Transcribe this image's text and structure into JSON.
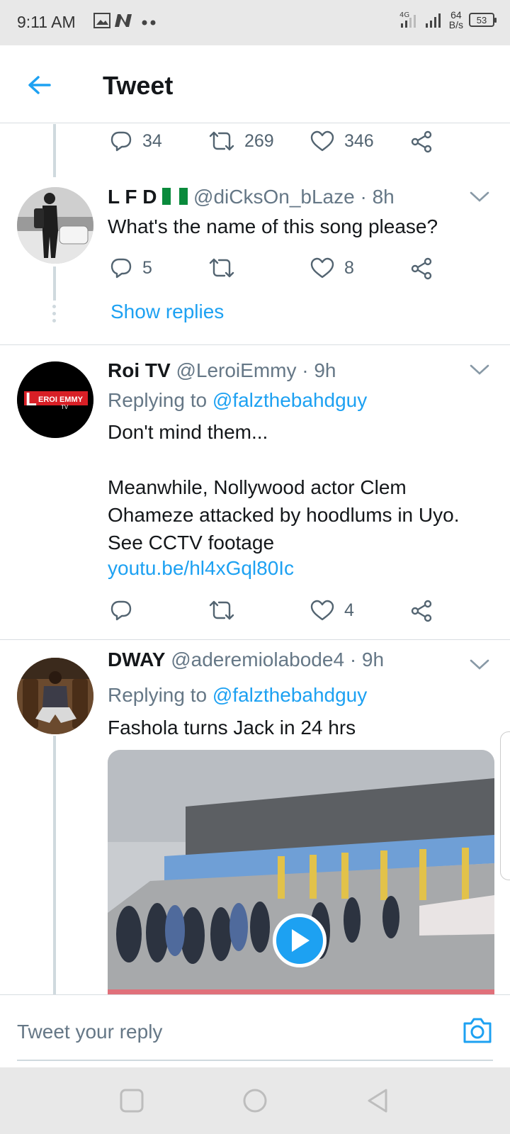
{
  "status_bar": {
    "time": "9:11 AM",
    "network": "4G",
    "speed_value": "64",
    "speed_unit": "B/s",
    "battery": "53"
  },
  "header": {
    "title": "Tweet"
  },
  "prev_actions": {
    "replies": "34",
    "retweets": "269",
    "likes": "346"
  },
  "tweets": [
    {
      "name": "L F D",
      "flag": "🇳🇬",
      "handle": "@diCksOn_bLaze",
      "time": "· 8h",
      "text": "What's the name of this song please?",
      "replies": "5",
      "retweets": "",
      "likes": "8",
      "show_replies": "Show replies"
    },
    {
      "name": "Roi TV",
      "handle": "@LeroiEmmy",
      "time": "· 9h",
      "replying_label": "Replying to",
      "replying_to": "@falzthebahdguy",
      "text": "Don't mind them...\n\nMeanwhile, Nollywood actor Clem\nOhameze attacked by hoodlums in Uyo.\nSee CCTV footage",
      "link": "youtu.be/hl4xGql80Ic",
      "avatar_text_big": "L",
      "avatar_text": "EROI EMMY",
      "avatar_text_small": "TV",
      "replies": "",
      "retweets": "",
      "likes": "4"
    },
    {
      "name": "DWAY",
      "handle": "@aderemiolabode4",
      "time": "· 9h",
      "replying_label": "Replying to",
      "replying_to": "@falzthebahdguy",
      "text": "Fashola turns Jack in 24 hrs"
    }
  ],
  "reply_bar": {
    "placeholder": "Tweet your reply"
  },
  "colors": {
    "accent": "#1da1f2",
    "muted": "#657786",
    "text": "#14171a"
  },
  "icons": [
    "back-arrow-icon",
    "reply-icon",
    "retweet-icon",
    "like-icon",
    "share-icon",
    "chevron-down-icon",
    "camera-icon",
    "play-icon"
  ]
}
